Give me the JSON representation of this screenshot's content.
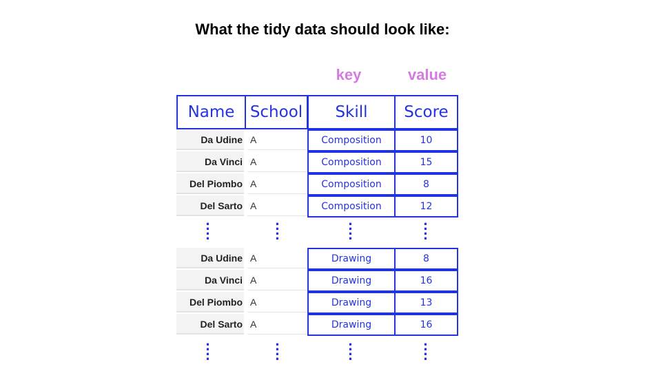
{
  "title": "What the tidy data should look like:",
  "labels": {
    "key": "key",
    "value": "value"
  },
  "headers": {
    "name": "Name",
    "school": "School",
    "skill": "Skill",
    "score": "Score"
  },
  "group1": [
    {
      "name": "Da Udine",
      "school": "A",
      "skill": "Composition",
      "score": "10"
    },
    {
      "name": "Da Vinci",
      "school": "A",
      "skill": "Composition",
      "score": "15"
    },
    {
      "name": "Del Piombo",
      "school": "A",
      "skill": "Composition",
      "score": "8"
    },
    {
      "name": "Del Sarto",
      "school": "A",
      "skill": "Composition",
      "score": "12"
    }
  ],
  "group2": [
    {
      "name": "Da Udine",
      "school": "A",
      "skill": "Drawing",
      "score": "8"
    },
    {
      "name": "Da Vinci",
      "school": "A",
      "skill": "Drawing",
      "score": "16"
    },
    {
      "name": "Del Piombo",
      "school": "A",
      "skill": "Drawing",
      "score": "13"
    },
    {
      "name": "Del Sarto",
      "school": "A",
      "skill": "Drawing",
      "score": "16"
    }
  ],
  "colors": {
    "accent_blue": "#2433e0",
    "label_pink": "#d57ae0"
  }
}
